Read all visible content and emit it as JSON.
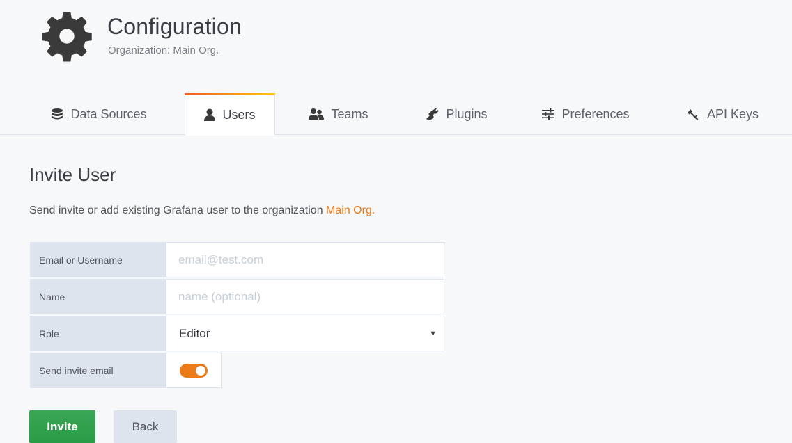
{
  "header": {
    "title": "Configuration",
    "subtitle": "Organization: Main Org.",
    "icon": "gear-icon"
  },
  "tabs": [
    {
      "label": "Data Sources",
      "icon": "database-icon",
      "active": false
    },
    {
      "label": "Users",
      "icon": "user-icon",
      "active": true
    },
    {
      "label": "Teams",
      "icon": "users-icon",
      "active": false
    },
    {
      "label": "Plugins",
      "icon": "plug-icon",
      "active": false
    },
    {
      "label": "Preferences",
      "icon": "sliders-icon",
      "active": false
    },
    {
      "label": "API Keys",
      "icon": "key-icon",
      "active": false
    }
  ],
  "invite": {
    "title": "Invite User",
    "description": "Send invite or add existing Grafana user to the organization ",
    "org_name": "Main Org."
  },
  "form": {
    "email_label": "Email or Username",
    "email_placeholder": "email@test.com",
    "email_value": "",
    "name_label": "Name",
    "name_placeholder": "name (optional)",
    "name_value": "",
    "role_label": "Role",
    "role_value": "Editor",
    "send_email_label": "Send invite email",
    "send_email_enabled": true
  },
  "buttons": {
    "invite_label": "Invite",
    "back_label": "Back"
  },
  "colors": {
    "accent": "#eb7b18",
    "success": "#299c46",
    "label_bg": "#dde4ed"
  }
}
